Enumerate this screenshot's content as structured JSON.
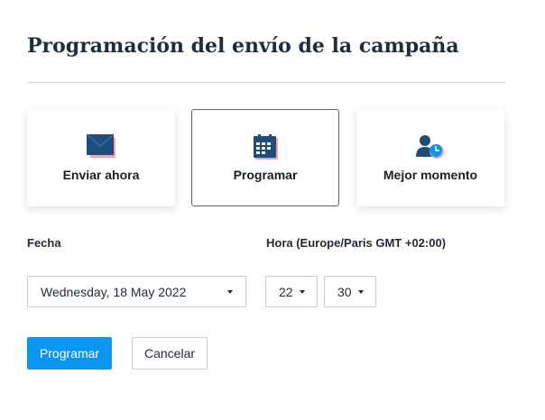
{
  "header": {
    "title": "Programación del envío de la campaña"
  },
  "options": [
    {
      "label": "Enviar ahora",
      "icon": "envelope-icon",
      "selected": false
    },
    {
      "label": "Programar",
      "icon": "calendar-icon",
      "selected": true
    },
    {
      "label": "Mejor momento",
      "icon": "user-clock-icon",
      "selected": false
    }
  ],
  "form": {
    "date_label": "Fecha",
    "date_value": "Wednesday, 18 May 2022",
    "time_label": "Hora (Europe/Paris GMT +02:00)",
    "hour_value": "22",
    "minute_value": "30"
  },
  "actions": {
    "schedule_label": "Programar",
    "cancel_label": "Cancelar"
  },
  "colors": {
    "primary": "#0a96f0",
    "icon_navy": "#1e4d7b",
    "icon_accent": "#f4a4ad",
    "icon_blue": "#0a96f0"
  }
}
